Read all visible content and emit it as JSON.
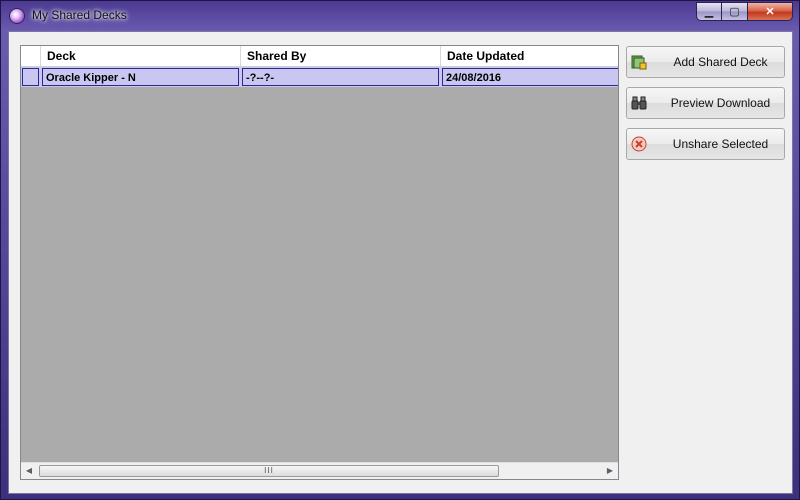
{
  "window": {
    "title": "My Shared Decks",
    "caption": {
      "minimize": "▁",
      "maximize": "▢",
      "close": "✕"
    }
  },
  "grid": {
    "columns": [
      "Deck",
      "Shared By",
      "Date Updated"
    ],
    "rows": [
      {
        "deck": "Oracle Kipper - N",
        "shared_by": "-?--?-",
        "date_updated": "24/08/2016"
      }
    ],
    "scroll_thumb_grip": "III"
  },
  "actions": {
    "add_label": "Add Shared Deck",
    "preview_label": "Preview Download",
    "unshare_label": "Unshare Selected"
  },
  "colors": {
    "selection": "#c9c7f2",
    "grid_empty": "#ababab"
  }
}
